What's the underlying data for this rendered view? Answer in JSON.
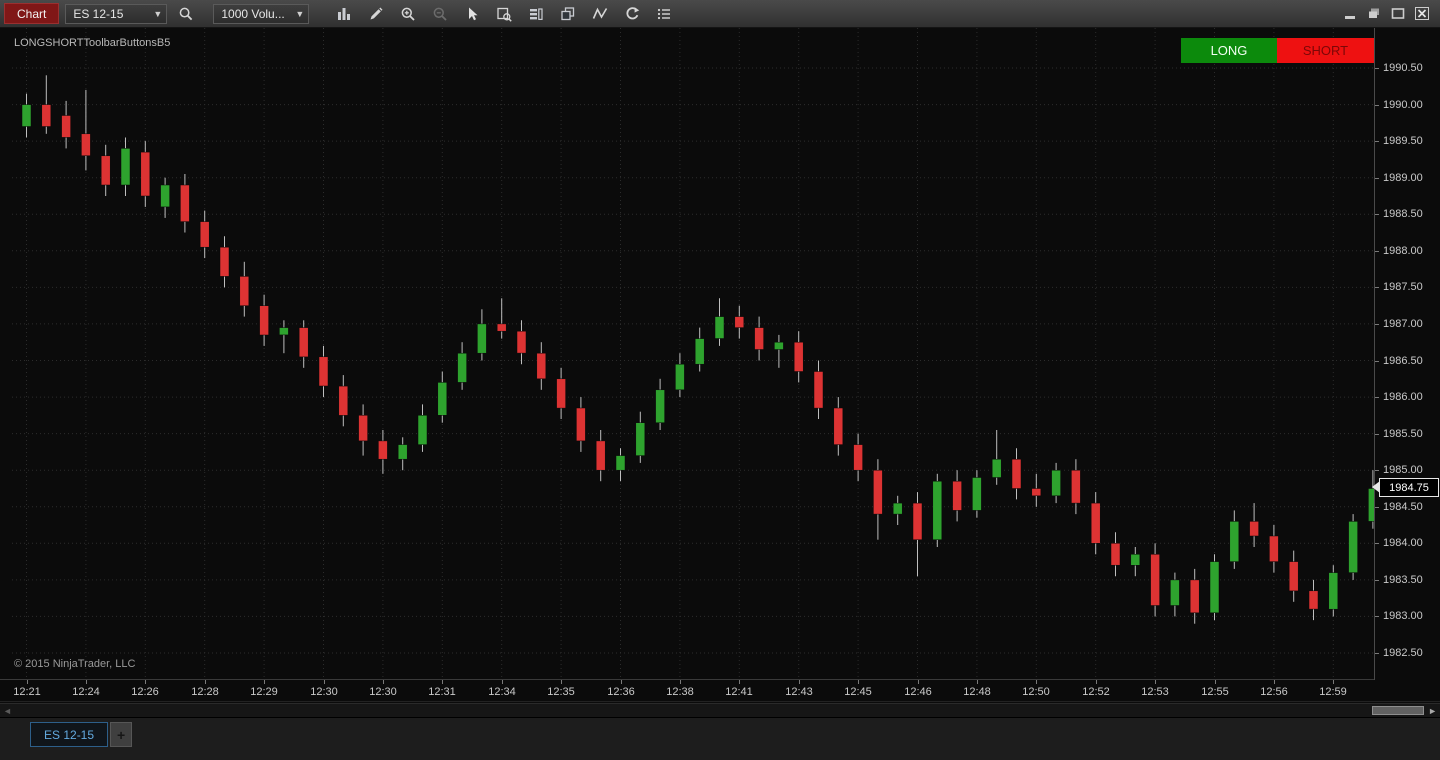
{
  "window": {
    "controls": [
      "minimize",
      "restore",
      "maximize",
      "close"
    ]
  },
  "toolbar": {
    "chart_menu_label": "Chart",
    "instrument_value": "ES 12-15",
    "interval_value": "1000 Volu...",
    "icon_names": [
      "instrument-search-icon",
      "chart-style-icon",
      "drawing-tools-icon",
      "zoom-in-icon",
      "zoom-out-icon",
      "pointer-icon",
      "data-box-icon",
      "chart-trader-icon",
      "strategies-icon",
      "indicators-icon",
      "reload-icon",
      "properties-icon"
    ]
  },
  "chart": {
    "strategy_label": "LONGSHORTToolbarButtonsB5",
    "long_button_label": "LONG",
    "short_button_label": "SHORT",
    "last_price": "1984.75",
    "copyright": "© 2015 NinjaTrader, LLC",
    "colors": {
      "background": "#0b0b0b",
      "grid": "#2c2c2c",
      "up": "#2ea32e",
      "down": "#dd3333",
      "wick": "#bfbfbf",
      "axis_text": "#c9c9c9",
      "long_bg": "#0c8a0c",
      "long_text": "#f2fff2",
      "short_bg": "#ee1111",
      "short_text": "#7c0707",
      "marker_bg": "#000000",
      "marker_border": "#e8e8e8",
      "marker_text": "#ffffff"
    }
  },
  "chart_data": {
    "type": "candlestick",
    "instrument": "ES 12-15",
    "interval": "1000 Volume",
    "ylim": [
      1982.5,
      1990.5
    ],
    "price_step": 0.5,
    "grid": "dotted",
    "price_labels": [
      "1990.50",
      "1990.00",
      "1989.50",
      "1989.00",
      "1988.50",
      "1988.00",
      "1987.50",
      "1987.00",
      "1986.50",
      "1986.00",
      "1985.50",
      "1985.00",
      "1984.50",
      "1984.00",
      "1983.50",
      "1983.00",
      "1982.50"
    ],
    "time_labels": [
      "12:21",
      "12:24",
      "12:26",
      "12:28",
      "12:29",
      "12:30",
      "12:30",
      "12:31",
      "12:34",
      "12:35",
      "12:36",
      "12:38",
      "12:41",
      "12:43",
      "12:45",
      "12:46",
      "12:48",
      "12:50",
      "12:52",
      "12:53",
      "12:55",
      "12:56",
      "12:59"
    ],
    "candles_per_label": 3,
    "candles_format": "[open, high, low, close]",
    "last_price": 1984.75,
    "candles": [
      [
        1989.7,
        1990.15,
        1989.55,
        1990.0
      ],
      [
        1990.0,
        1990.4,
        1989.6,
        1989.7
      ],
      [
        1989.85,
        1990.05,
        1989.4,
        1989.55
      ],
      [
        1989.6,
        1990.2,
        1989.1,
        1989.3
      ],
      [
        1989.3,
        1989.45,
        1988.75,
        1988.9
      ],
      [
        1988.9,
        1989.55,
        1988.75,
        1989.4
      ],
      [
        1989.35,
        1989.5,
        1988.6,
        1988.75
      ],
      [
        1988.6,
        1989.0,
        1988.45,
        1988.9
      ],
      [
        1988.9,
        1989.05,
        1988.25,
        1988.4
      ],
      [
        1988.4,
        1988.55,
        1987.9,
        1988.05
      ],
      [
        1988.05,
        1988.2,
        1987.5,
        1987.65
      ],
      [
        1987.65,
        1987.85,
        1987.1,
        1987.25
      ],
      [
        1987.25,
        1987.4,
        1986.7,
        1986.85
      ],
      [
        1986.85,
        1987.05,
        1986.6,
        1986.95
      ],
      [
        1986.95,
        1987.05,
        1986.4,
        1986.55
      ],
      [
        1986.55,
        1986.7,
        1986.0,
        1986.15
      ],
      [
        1986.15,
        1986.3,
        1985.6,
        1985.75
      ],
      [
        1985.75,
        1985.9,
        1985.2,
        1985.4
      ],
      [
        1985.4,
        1985.55,
        1984.95,
        1985.15
      ],
      [
        1985.15,
        1985.45,
        1985.0,
        1985.35
      ],
      [
        1985.35,
        1985.9,
        1985.25,
        1985.75
      ],
      [
        1985.75,
        1986.35,
        1985.65,
        1986.2
      ],
      [
        1986.2,
        1986.75,
        1986.1,
        1986.6
      ],
      [
        1986.6,
        1987.2,
        1986.5,
        1987.0
      ],
      [
        1987.0,
        1987.35,
        1986.8,
        1986.9
      ],
      [
        1986.9,
        1987.05,
        1986.45,
        1986.6
      ],
      [
        1986.6,
        1986.75,
        1986.1,
        1986.25
      ],
      [
        1986.25,
        1986.4,
        1985.7,
        1985.85
      ],
      [
        1985.85,
        1986.0,
        1985.25,
        1985.4
      ],
      [
        1985.4,
        1985.55,
        1984.85,
        1985.0
      ],
      [
        1985.0,
        1985.3,
        1984.85,
        1985.2
      ],
      [
        1985.2,
        1985.8,
        1985.1,
        1985.65
      ],
      [
        1985.65,
        1986.25,
        1985.55,
        1986.1
      ],
      [
        1986.1,
        1986.6,
        1986.0,
        1986.45
      ],
      [
        1986.45,
        1986.95,
        1986.35,
        1986.8
      ],
      [
        1986.8,
        1987.35,
        1986.7,
        1987.1
      ],
      [
        1987.1,
        1987.25,
        1986.8,
        1986.95
      ],
      [
        1986.95,
        1987.1,
        1986.5,
        1986.65
      ],
      [
        1986.65,
        1986.85,
        1986.4,
        1986.75
      ],
      [
        1986.75,
        1986.9,
        1986.2,
        1986.35
      ],
      [
        1986.35,
        1986.5,
        1985.7,
        1985.85
      ],
      [
        1985.85,
        1986.0,
        1985.2,
        1985.35
      ],
      [
        1985.35,
        1985.5,
        1984.85,
        1985.0
      ],
      [
        1985.0,
        1985.15,
        1984.05,
        1984.4
      ],
      [
        1984.4,
        1984.65,
        1984.25,
        1984.55
      ],
      [
        1984.55,
        1984.7,
        1983.55,
        1984.05
      ],
      [
        1984.05,
        1984.95,
        1983.95,
        1984.85
      ],
      [
        1984.85,
        1985.0,
        1984.3,
        1984.45
      ],
      [
        1984.45,
        1985.0,
        1984.35,
        1984.9
      ],
      [
        1984.9,
        1985.55,
        1984.8,
        1985.15
      ],
      [
        1985.15,
        1985.3,
        1984.6,
        1984.75
      ],
      [
        1984.75,
        1984.95,
        1984.5,
        1984.65
      ],
      [
        1984.65,
        1985.1,
        1984.55,
        1985.0
      ],
      [
        1985.0,
        1985.15,
        1984.4,
        1984.55
      ],
      [
        1984.55,
        1984.7,
        1983.85,
        1984.0
      ],
      [
        1984.0,
        1984.15,
        1983.55,
        1983.7
      ],
      [
        1983.7,
        1983.95,
        1983.55,
        1983.85
      ],
      [
        1983.85,
        1984.0,
        1983.0,
        1983.15
      ],
      [
        1983.15,
        1983.6,
        1983.0,
        1983.5
      ],
      [
        1983.5,
        1983.65,
        1982.9,
        1983.05
      ],
      [
        1983.05,
        1983.85,
        1982.95,
        1983.75
      ],
      [
        1983.75,
        1984.45,
        1983.65,
        1984.3
      ],
      [
        1984.3,
        1984.55,
        1983.95,
        1984.1
      ],
      [
        1984.1,
        1984.25,
        1983.6,
        1983.75
      ],
      [
        1983.75,
        1983.9,
        1983.2,
        1983.35
      ],
      [
        1983.35,
        1983.5,
        1982.95,
        1983.1
      ],
      [
        1983.1,
        1983.7,
        1983.0,
        1983.6
      ],
      [
        1983.6,
        1984.4,
        1983.5,
        1984.3
      ],
      [
        1984.3,
        1985.0,
        1984.2,
        1984.75
      ]
    ]
  },
  "tabs": {
    "active_label": "ES 12-15",
    "add_label": "+"
  }
}
